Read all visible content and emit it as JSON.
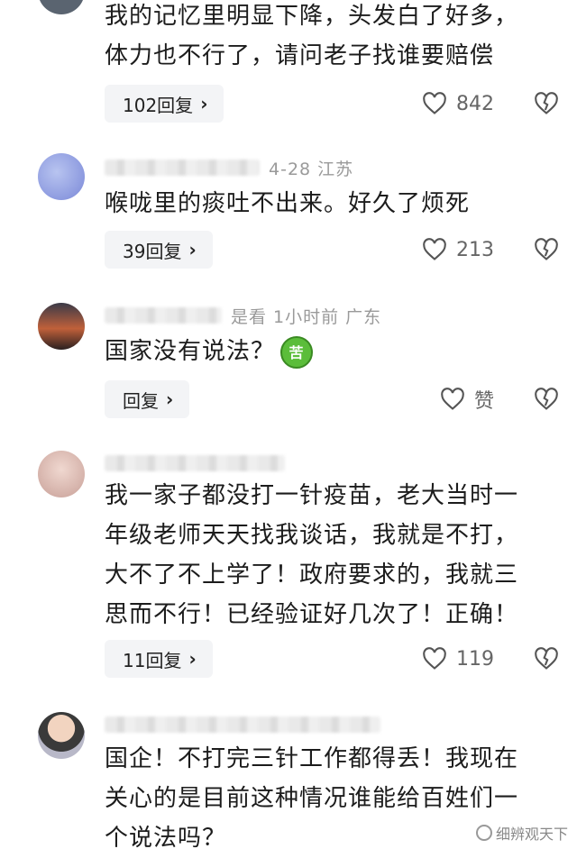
{
  "comments": [
    {
      "text_lines": [
        "我的记忆里明显下降，头发白了好多，",
        "体力也不行了，请问老子找谁要赔偿"
      ],
      "reply_label": "102回复",
      "likes": "842"
    },
    {
      "meta": "4-28  江苏",
      "text_lines": [
        "喉咙里的痰吐不出来。好久了烦死"
      ],
      "reply_label": "39回复",
      "likes": "213"
    },
    {
      "meta": "是看  1小时前  广东",
      "text_lines": [
        "国家没有说法？"
      ],
      "sticker": "苦",
      "reply_label": "回复",
      "likes": "赞"
    },
    {
      "text_lines": [
        "我一家子都没打一针疫苗，老大当时一",
        "年级老师天天找我谈话，我就是不打，",
        "大不了不上学了！政府要求的，我就三",
        "思而不行！已经验证好几次了！正确！"
      ],
      "reply_label": "11回复",
      "likes": "119"
    },
    {
      "text_lines": [
        "国企！不打完三针工作都得丢！我现在",
        "关心的是目前这种情况谁能给百姓们一",
        "个说法吗？"
      ]
    }
  ],
  "watermark": "细辨观天下",
  "colors": {
    "reply_bg": "#f3f4f6",
    "meta_gray": "#9a9a9a",
    "text": "#1c1c1c"
  }
}
